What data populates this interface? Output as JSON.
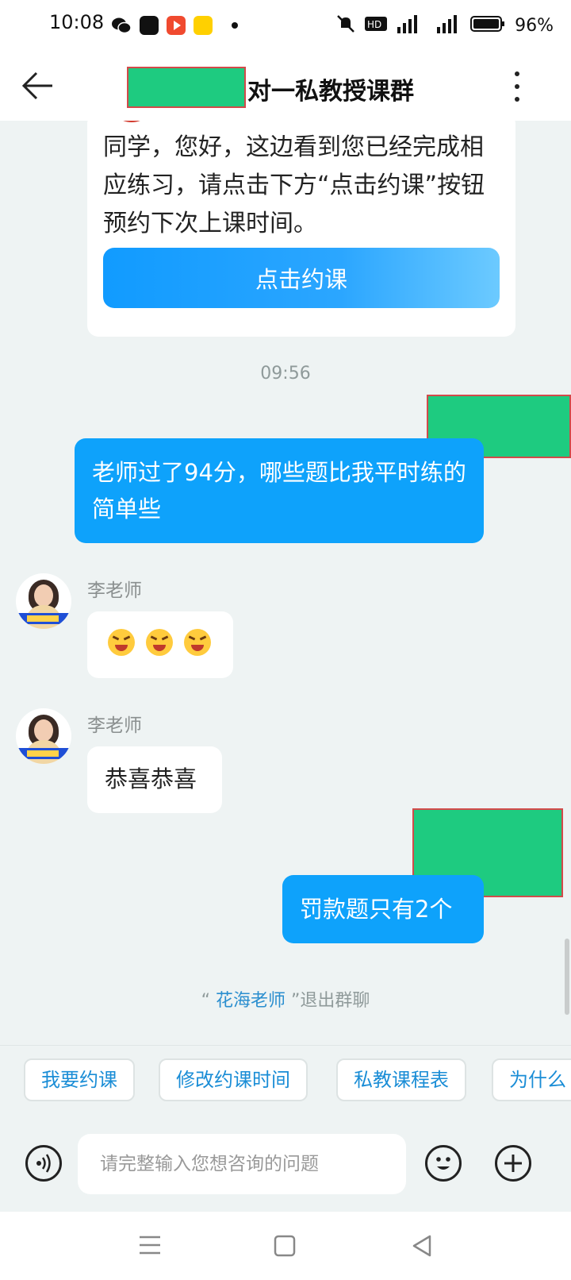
{
  "status_bar": {
    "time": "10:08",
    "network": "5G 4G",
    "battery": "96%"
  },
  "header": {
    "title": "对一私教授课群"
  },
  "messages": {
    "card_text": "同学，您好，这边看到您已经完成相应练习，请点击下方“点击约课”按钮预约下次上课时间。",
    "card_button": "点击约课",
    "timestamp": "09:56",
    "me_1": "老师过了94分，哪些题比我平时练的简单些",
    "sender_1": "李老师",
    "sender_2": "李老师",
    "other_2": "恭喜恭喜",
    "me_2": "罚款题只有2个",
    "notice_prefix": "“",
    "notice_name": "花海老师",
    "notice_suffix": "”退出群聊"
  },
  "quick_replies": [
    "我要约课",
    "修改约课时间",
    "私教课程表",
    "为什么"
  ],
  "composer": {
    "placeholder": "请完整输入您想咨询的问题"
  },
  "colors": {
    "accent": "#0ea2fb",
    "redaction": "#1ecb80",
    "redaction_border": "#d24a4a"
  },
  "icons": [
    "wechat-icon",
    "app-icon-dewu",
    "app-icon-video",
    "app-icon-meituan",
    "mute-icon",
    "hd-icon",
    "signal-icon",
    "battery-icon",
    "back-arrow-icon",
    "more-vertical-icon",
    "voice-icon",
    "emoji-icon",
    "plus-icon",
    "nav-menu-icon",
    "nav-home-icon",
    "nav-back-icon"
  ]
}
